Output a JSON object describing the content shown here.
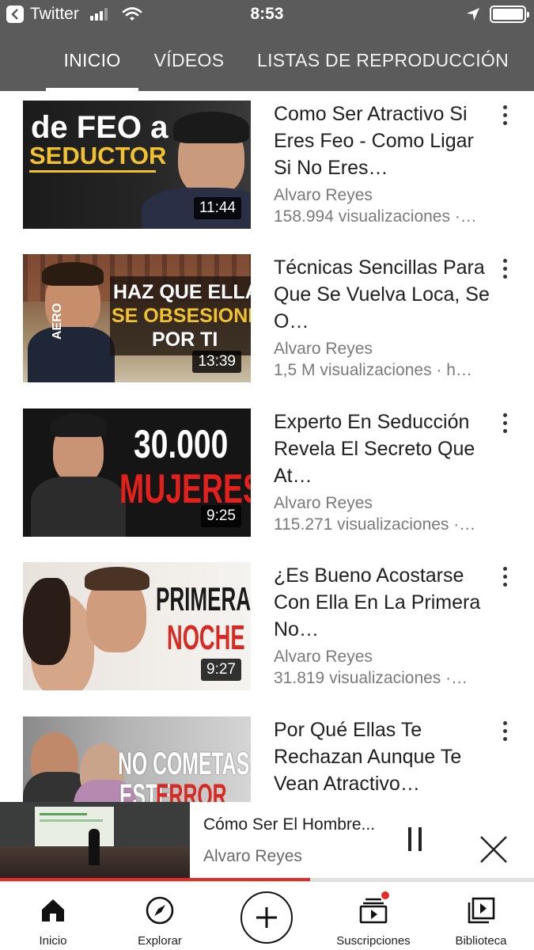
{
  "status_bar": {
    "back_app": "Twitter",
    "time": "8:53"
  },
  "tabs": [
    {
      "label": "INICIO"
    },
    {
      "label": "VÍDEOS"
    },
    {
      "label": "LISTAS DE REPRODUCCIÓN"
    }
  ],
  "videos": [
    {
      "title": "Como Ser Atractivo Si Eres Feo - Como Ligar Si No Eres…",
      "channel": "Alvaro Reyes",
      "views": "158.994 visualizaciones ·…",
      "duration": "11:44",
      "thumb_line1": "de FEO a",
      "thumb_line2": "SEDUCTOR"
    },
    {
      "title": "Técnicas Sencillas Para Que Se Vuelva Loca, Se O…",
      "channel": "Alvaro Reyes",
      "views": "1,5 M visualizaciones · h…",
      "duration": "13:39",
      "thumb_line1": "HAZ QUE ELLA",
      "thumb_line2": "SE OBSESIONE",
      "thumb_line3": "POR TI",
      "shirt_text": "AERO"
    },
    {
      "title": "Experto En Seducción Revela El Secreto Que At…",
      "channel": "Alvaro Reyes",
      "views": "115.271 visualizaciones ·…",
      "duration": "9:25",
      "thumb_line1": "30.000",
      "thumb_line2": "MUJERES"
    },
    {
      "title": "¿Es Bueno Acostarse Con Ella En La Primera No…",
      "channel": "Alvaro Reyes",
      "views": "31.819 visualizaciones ·…",
      "duration": "9:27",
      "thumb_line1": "PRIMERA",
      "thumb_line2": "NOCHE"
    },
    {
      "title": "Por Qué Ellas Te Rechazan Aunque Te Vean Atractivo…",
      "channel": "Alvaro Reyes",
      "views": "",
      "duration": "",
      "thumb_line1": "NO COMETAS",
      "thumb_line2": "ESTE",
      "thumb_line3": "ERROR"
    }
  ],
  "mini_player": {
    "title": "Cómo Ser El Hombre...",
    "channel": "Alvaro Reyes",
    "progress": 0.58,
    "behind_text": "la Alvaro Reyes con Cám"
  },
  "bottom_nav": [
    {
      "label": "Inicio",
      "icon": "home-icon"
    },
    {
      "label": "Explorar",
      "icon": "compass-icon"
    },
    {
      "label": "",
      "icon": "plus-icon"
    },
    {
      "label": "Suscripciones",
      "icon": "subscriptions-icon"
    },
    {
      "label": "Biblioteca",
      "icon": "library-icon"
    }
  ],
  "colors": {
    "header_bg": "#5b5b5b",
    "accent_red": "#e52d27",
    "text_primary": "#202020",
    "text_secondary": "#7a7a7a"
  }
}
